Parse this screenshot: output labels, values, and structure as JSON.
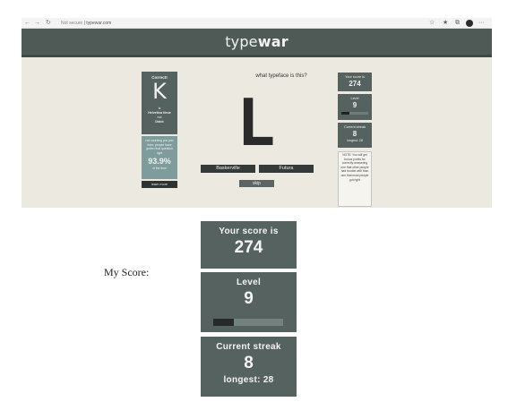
{
  "browser": {
    "back_icon": "←",
    "forward_icon": "→",
    "reload_icon": "↻",
    "security_text": "Not secure",
    "url": "typewar.com",
    "more_icon": "···"
  },
  "site": {
    "logo_prefix": "type",
    "logo_bold": "war",
    "question": "what typeface is this?",
    "display_letter": "L",
    "choices": [
      "Baskerville",
      "Futura"
    ],
    "skip_label": "skip",
    "correct_card": {
      "title": "Correct!",
      "letter": "K",
      "line1": "is",
      "font_name": "Helvetica Neue",
      "line3": "not",
      "other_font": "Didot"
    },
    "stat_card": {
      "text": "not counting you just then, people have gotten that question right",
      "percent": "93.9%",
      "suffix": "of the time"
    },
    "learn_more_label": "learn more",
    "score": {
      "label": "Your score is",
      "value": "274"
    },
    "level": {
      "label": "Level",
      "value": "9",
      "progress": 0.3
    },
    "streak": {
      "label": "Current streak",
      "value": "8",
      "longest": "longest: 28"
    },
    "note": "NOTE: You will get bonus points for correctly answering one that other people had trouble with than one that most people got right"
  },
  "my_score": {
    "label": "My Score:",
    "score": {
      "label": "Your score is",
      "value": "274"
    },
    "level": {
      "label": "Level",
      "value": "9",
      "progress": 0.3
    },
    "streak": {
      "label": "Current streak",
      "value": "8",
      "longest": "longest: 28"
    }
  }
}
